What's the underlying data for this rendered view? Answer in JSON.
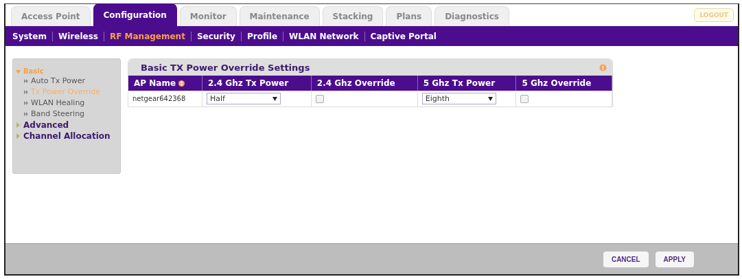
{
  "tabs": [
    {
      "label": "Access Point",
      "selected": false
    },
    {
      "label": "Configuration",
      "selected": true
    },
    {
      "label": "Monitor",
      "selected": false
    },
    {
      "label": "Maintenance",
      "selected": false
    },
    {
      "label": "Stacking",
      "selected": false
    },
    {
      "label": "Plans",
      "selected": false
    },
    {
      "label": "Diagnostics",
      "selected": false
    }
  ],
  "logout": "LOGOUT",
  "subnav": [
    {
      "label": "System",
      "selected": false
    },
    {
      "label": "Wireless",
      "selected": false
    },
    {
      "label": "RF Management",
      "selected": true
    },
    {
      "label": "Security",
      "selected": false
    },
    {
      "label": "Profile",
      "selected": false
    },
    {
      "label": "WLAN Network",
      "selected": false
    },
    {
      "label": "Captive Portal",
      "selected": false
    }
  ],
  "sidebar": {
    "items": [
      {
        "label": "Basic",
        "selected": true,
        "expanded": true,
        "children": [
          {
            "label": "Auto Tx Power",
            "selected": false
          },
          {
            "label": "Tx Power Override",
            "selected": true
          },
          {
            "label": "WLAN Healing",
            "selected": false
          },
          {
            "label": "Band Steering",
            "selected": false
          }
        ]
      },
      {
        "label": "Advanced",
        "selected": false,
        "expanded": false
      },
      {
        "label": "Channel Allocation",
        "selected": false,
        "expanded": false
      }
    ]
  },
  "panel": {
    "title": "Basic TX Power Override Settings",
    "table": {
      "columns": [
        "AP Name",
        "2.4 Ghz Tx Power",
        "2.4 Ghz Override",
        "5 Ghz Tx Power",
        "5 Ghz Override"
      ],
      "rows": [
        {
          "ap_name": "netgear642368",
          "tx_24": "Half",
          "override_24": false,
          "tx_5": "Eighth",
          "override_5": false
        }
      ]
    }
  },
  "buttons": [
    "CANCEL",
    "APPLY"
  ]
}
